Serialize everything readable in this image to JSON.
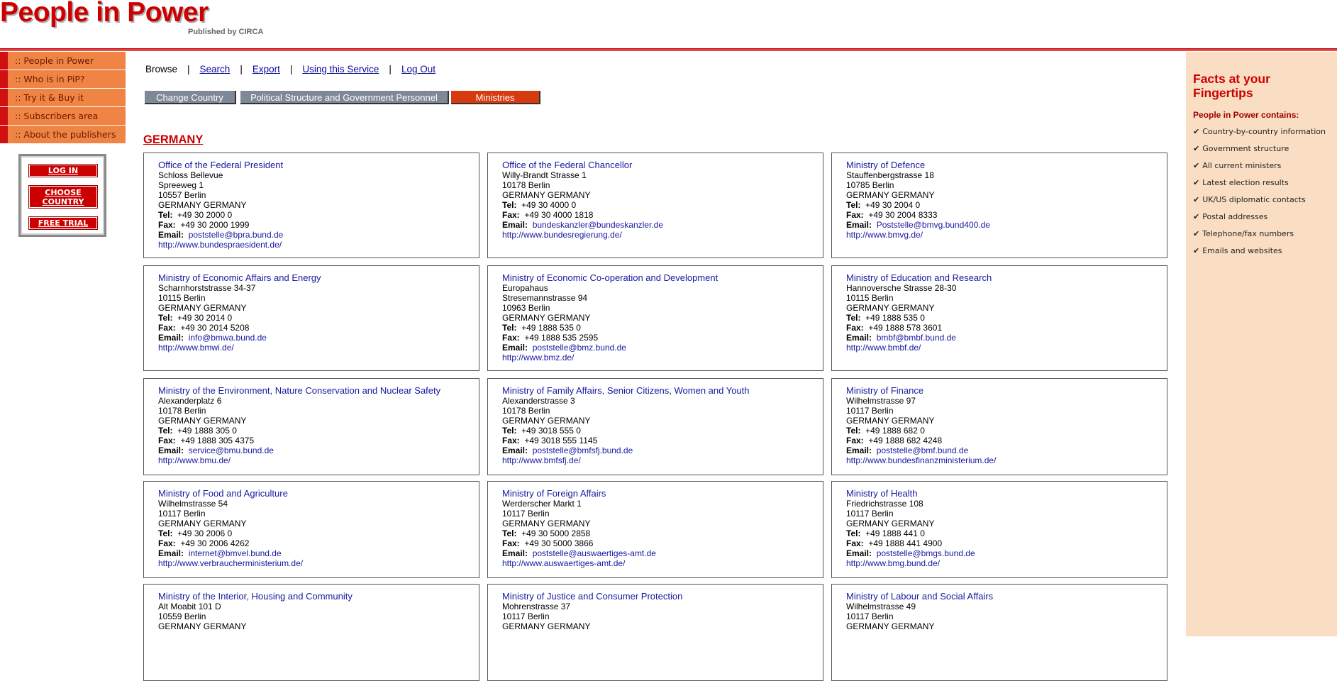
{
  "header": {
    "logo_text": "People in Power",
    "logo_sub": "Published by CIRCA"
  },
  "nav": [
    ":: People in Power",
    ":: Who is in PiP?",
    ":: Try it & Buy it",
    ":: Subscribers area",
    ":: About the publishers"
  ],
  "login_box": {
    "login": "LOG IN",
    "choose_country": "CHOOSE COUNTRY",
    "free_trial": "FREE TRIAL"
  },
  "top_links": {
    "browse": "Browse",
    "search": "Search",
    "export": "Export",
    "using": "Using this Service",
    "logout": "Log Out",
    "separator": "|"
  },
  "tabs": {
    "change_country": "Change Country",
    "political_structure": "Political Structure and Government Personnel",
    "ministries": "Ministries"
  },
  "country": "GERMANY",
  "labels": {
    "tel": "Tel:",
    "fax": "Fax:",
    "email": "Email:"
  },
  "ministries": [
    {
      "name": "Office of the Federal President",
      "address": [
        "Schloss Bellevue",
        "Spreeweg 1",
        "10557 Berlin",
        "GERMANY GERMANY"
      ],
      "tel": "+49 30 2000 0",
      "fax": "+49 30 2000 1999",
      "email": "poststelle@bpra.bund.de",
      "web": "http://www.bundespraesident.de/"
    },
    {
      "name": "Office of the Federal Chancellor",
      "address": [
        "Willy-Brandt Strasse 1",
        "10178 Berlin",
        "GERMANY GERMANY"
      ],
      "tel": "+49 30 4000 0",
      "fax": "+49 30 4000 1818",
      "email": "bundeskanzler@bundeskanzler.de",
      "web": "http://www.bundesregierung.de/"
    },
    {
      "name": "Ministry of Defence",
      "address": [
        "Stauffenbergstrasse 18",
        "10785 Berlin",
        "GERMANY GERMANY"
      ],
      "tel": "+49 30 2004 0",
      "fax": "+49 30 2004 8333",
      "email": "Poststelle@bmvg.bund400.de",
      "web": "http://www.bmvg.de/"
    },
    {
      "name": "Ministry of Economic Affairs and Energy",
      "address": [
        "Scharnhorststrasse 34-37",
        "10115 Berlin",
        "GERMANY GERMANY"
      ],
      "tel": "+49 30 2014 0",
      "fax": "+49 30 2014 5208",
      "email": "info@bmwa.bund.de",
      "web": "http://www.bmwi.de/"
    },
    {
      "name": "Ministry of Economic Co-operation and Development",
      "address": [
        "Europahaus",
        "Stresemannstrasse 94",
        "10963 Berlin",
        "GERMANY GERMANY"
      ],
      "tel": "+49 1888 535 0",
      "fax": "+49 1888 535 2595",
      "email": "poststelle@bmz.bund.de",
      "web": "http://www.bmz.de/"
    },
    {
      "name": "Ministry of Education and Research",
      "address": [
        "Hannoversche Strasse 28-30",
        "10115 Berlin",
        "GERMANY GERMANY"
      ],
      "tel": "+49 1888 535 0",
      "fax": "+49 1888 578 3601",
      "email": "bmbf@bmbf.bund.de",
      "web": "http://www.bmbf.de/"
    },
    {
      "name": "Ministry of the Environment, Nature Conservation and Nuclear Safety",
      "address": [
        "Alexanderplatz 6",
        "10178 Berlin",
        "GERMANY GERMANY"
      ],
      "tel": "+49 1888 305 0",
      "fax": "+49 1888 305 4375",
      "email": "service@bmu.bund.de",
      "web": "http://www.bmu.de/"
    },
    {
      "name": "Ministry of Family Affairs, Senior Citizens, Women and Youth",
      "address": [
        "Alexanderstrasse 3",
        "10178 Berlin",
        "GERMANY GERMANY"
      ],
      "tel": "+49 3018 555 0",
      "fax": "+49 3018 555 1145",
      "email": "poststelle@bmfsfj.bund.de",
      "web": "http://www.bmfsfj.de/"
    },
    {
      "name": "Ministry of Finance",
      "address": [
        "Wilhelmstrasse 97",
        "10117 Berlin",
        "GERMANY GERMANY"
      ],
      "tel": "+49 1888 682 0",
      "fax": "+49 1888 682 4248",
      "email": "poststelle@bmf.bund.de",
      "web": "http://www.bundesfinanzministerium.de/"
    },
    {
      "name": "Ministry of Food and Agriculture",
      "address": [
        "Wilhelmstrasse 54",
        "10117 Berlin",
        "GERMANY GERMANY"
      ],
      "tel": "+49 30 2006 0",
      "fax": "+49 30 2006 4262",
      "email": "internet@bmvel.bund.de",
      "web": "http://www.verbraucherministerium.de/"
    },
    {
      "name": "Ministry of Foreign Affairs",
      "address": [
        "Werderscher Markt 1",
        "10117 Berlin",
        "GERMANY GERMANY"
      ],
      "tel": "+49 30 5000 2858",
      "fax": "+49 30 5000 3866",
      "email": "poststelle@auswaertiges-amt.de",
      "web": "http://www.auswaertiges-amt.de/"
    },
    {
      "name": "Ministry of Health",
      "address": [
        "Friedrichstrasse 108",
        "10117 Berlin",
        "GERMANY GERMANY"
      ],
      "tel": "+49 1888 441 0",
      "fax": "+49 1888 441 4900",
      "email": "poststelle@bmgs.bund.de",
      "web": "http://www.bmg.bund.de/"
    },
    {
      "name": "Ministry of the Interior, Housing and Community",
      "address": [
        "Alt Moabit 101 D",
        "10559 Berlin",
        "GERMANY GERMANY"
      ],
      "tel": "",
      "fax": "",
      "email": "",
      "web": ""
    },
    {
      "name": "Ministry of Justice and Consumer Protection",
      "address": [
        "Mohrenstrasse 37",
        "10117 Berlin",
        "GERMANY GERMANY"
      ],
      "tel": "",
      "fax": "",
      "email": "",
      "web": ""
    },
    {
      "name": "Ministry of Labour and Social Affairs",
      "address": [
        "Wilhelmstrasse 49",
        "10117 Berlin",
        "GERMANY GERMANY"
      ],
      "tel": "",
      "fax": "",
      "email": "",
      "web": ""
    }
  ],
  "facts": {
    "title": "Facts at your Fingertips",
    "subtitle": "People in Power contains:",
    "check": "✔",
    "items": [
      "Country-by-country information",
      "Government structure",
      "All current ministers",
      "Latest election results",
      "UK/US diplomatic contacts",
      "Postal addresses",
      "Telephone/fax numbers",
      "Emails and websites"
    ]
  }
}
